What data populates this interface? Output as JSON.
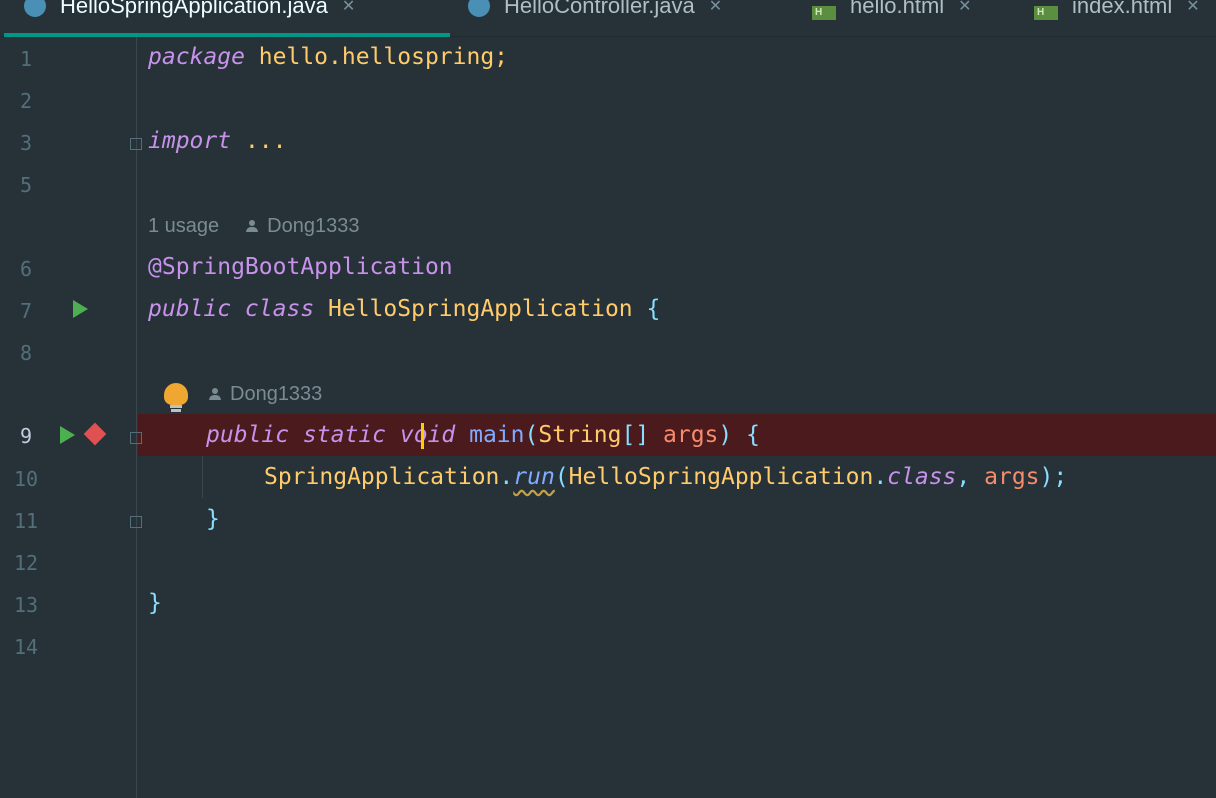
{
  "tabs": [
    {
      "label": "HelloSpringApplication.java",
      "icon": "java-class-icon",
      "active": true
    },
    {
      "label": "HelloController.java",
      "icon": "java-class-icon",
      "active": false
    },
    {
      "label": "hello.html",
      "icon": "html-file-icon",
      "active": false
    },
    {
      "label": "index.html",
      "icon": "html-file-icon",
      "active": false
    }
  ],
  "html_icon_letter": "H",
  "close_glyph": "✕",
  "line_numbers": [
    "1",
    "2",
    "3",
    "5",
    "6",
    "7",
    "8",
    "9",
    "10",
    "11",
    "12",
    "13",
    "14"
  ],
  "code": {
    "l1_kw": "package",
    "l1_rest": " hello.hellospring;",
    "l3_kw": "import",
    "l3_dots": " ...",
    "usage_hint": "1 usage",
    "author1": "Dong1333",
    "l6_annotation": "@SpringBootApplication",
    "l7_kw": "public class",
    "l7_cls": " HelloSpringApplication",
    "l7_brace": " {",
    "author2": "Dong1333",
    "l9_kw": "public static",
    "l9_void": " void",
    "l9_fn": " main",
    "l9_paren_open": "(",
    "l9_type": "String",
    "l9_arr": "[]",
    "l9_param": " args",
    "l9_paren_close": ") {",
    "l10_cls": "SpringApplication",
    "l10_dot1": ".",
    "l10_run": "run",
    "l10_paren_open": "(",
    "l10_cls2": "HelloSpringApplication",
    "l10_dot2": ".",
    "l10_kw": "class",
    "l10_comma": ", ",
    "l10_param": "args",
    "l10_end": ");",
    "l11_brace": "}",
    "l13_brace": "}"
  },
  "colors": {
    "background": "#263238",
    "keyword": "#c792ea",
    "class": "#ffcb6b",
    "function": "#82aaff",
    "parameter": "#f78c6c",
    "punctuation": "#89ddff",
    "breakpoint_line": "#4a1a1d",
    "tab_accent": "#009688"
  }
}
